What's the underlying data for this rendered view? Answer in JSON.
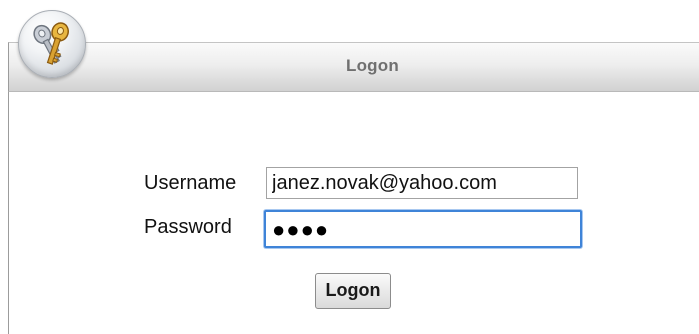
{
  "header": {
    "title": "Logon",
    "icon": "keys-icon"
  },
  "form": {
    "username_label": "Username",
    "username_value": "janez.novak@yahoo.com",
    "password_label": "Password",
    "password_mask": "●●●●",
    "submit_label": "Logon"
  },
  "colors": {
    "focus_border": "#3f84d8",
    "header_text": "#707070"
  }
}
